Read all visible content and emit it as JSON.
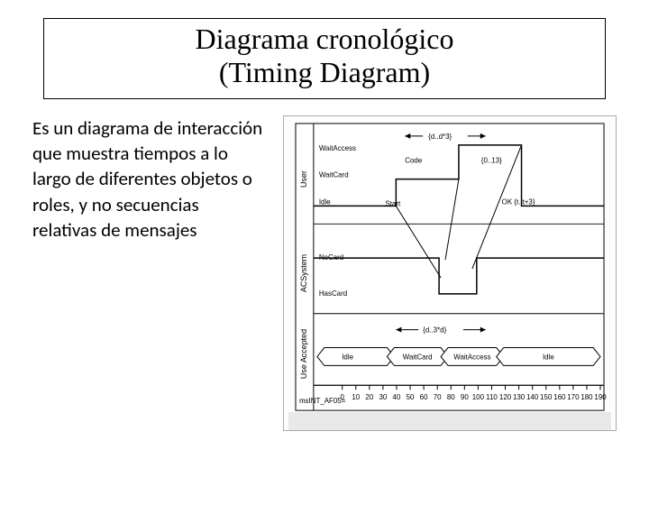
{
  "title": {
    "line1": "Diagrama cronológico",
    "line2": "(Timing Diagram)"
  },
  "description": "Es un diagrama de interacción que muestra tiempos a lo largo de diferentes objetos o roles, y no secuencias relativas de mensajes",
  "diagram": {
    "lane1": {
      "name": "User",
      "states": [
        "WaitAccess",
        "WaitCard",
        "Idle"
      ],
      "annotations": {
        "d1": "{d..d*3}",
        "code": "Code",
        "range": "{0..13}",
        "start": "Start",
        "ok": "OK {t..t+3}"
      }
    },
    "lane2": {
      "name": "ACSystem",
      "states": [
        "NoCard",
        "HasCard"
      ]
    },
    "lane3": {
      "name": "Use Accepted",
      "states": [
        "Idle",
        "WaitCard",
        "WaitAccess",
        "Idle"
      ],
      "annotation": "{d..3*d}"
    },
    "footer": "msINT_AF05=",
    "xaxis": {
      "ticks": [
        "0",
        "10",
        "20",
        "30",
        "40",
        "50",
        "60",
        "70",
        "80",
        "90",
        "100",
        "110",
        "120",
        "130",
        "140",
        "150",
        "160",
        "170",
        "180",
        "190"
      ]
    }
  }
}
